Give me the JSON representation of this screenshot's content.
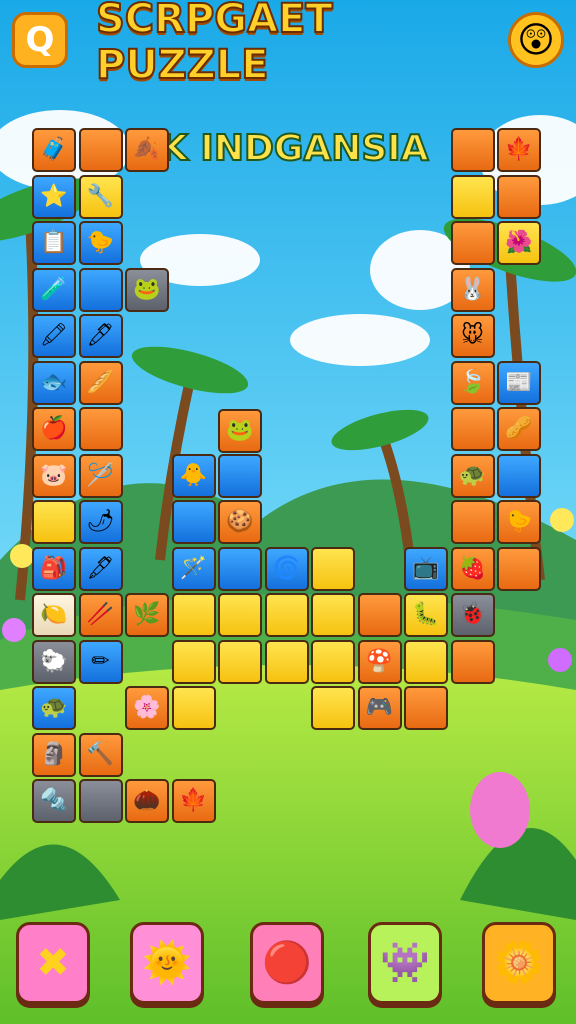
{
  "header": {
    "title": "SCRPGAET PUZZLE",
    "subtitle": "K INDGANSIA",
    "left_icon": "magnifier-q-icon",
    "right_icon": "smiley-face-icon"
  },
  "colors": {
    "sky": "#2fb7ea",
    "grass": "#7fd23c",
    "orange_tile": "#f07a1a",
    "yellow_tile": "#f8cf22",
    "blue_tile": "#1f86f0",
    "gray_tile": "#6c717b"
  },
  "board": {
    "tiles": [
      {
        "c": "orange",
        "icon": "🧳"
      },
      {
        "c": "orange",
        "icon": ""
      },
      {
        "c": "orange",
        "icon": "🍂"
      },
      {
        "c": "orange",
        "icon": ""
      },
      {
        "c": "orange",
        "icon": "🍁"
      },
      {
        "c": "blue",
        "icon": "⭐"
      },
      {
        "c": "yellow",
        "icon": "🔧"
      },
      {
        "c": "yellow",
        "icon": ""
      },
      {
        "c": "orange",
        "icon": ""
      },
      {
        "c": "blue",
        "icon": "📋"
      },
      {
        "c": "blue",
        "icon": "🐤"
      },
      {
        "c": "orange",
        "icon": ""
      },
      {
        "c": "yellow",
        "icon": "🌺"
      },
      {
        "c": "blue",
        "icon": "🧪"
      },
      {
        "c": "blue",
        "icon": ""
      },
      {
        "c": "gray",
        "icon": "🐸"
      },
      {
        "c": "orange",
        "icon": "🐰"
      },
      {
        "c": "blue",
        "icon": "🖍"
      },
      {
        "c": "blue",
        "icon": "🖊"
      },
      {
        "c": "orange",
        "icon": "🐭"
      },
      {
        "c": "blue",
        "icon": "🐟"
      },
      {
        "c": "orange",
        "icon": "🥖"
      },
      {
        "c": "orange",
        "icon": "🍃"
      },
      {
        "c": "blue",
        "icon": "📰"
      },
      {
        "c": "orange",
        "icon": "🍎"
      },
      {
        "c": "orange",
        "icon": ""
      },
      {
        "c": "orange",
        "icon": ""
      },
      {
        "c": "orange",
        "icon": "🥜"
      },
      {
        "c": "orange",
        "icon": "🐷"
      },
      {
        "c": "orange",
        "icon": "🪡"
      },
      {
        "c": "orange",
        "icon": "🐸"
      },
      {
        "c": "orange",
        "icon": "🐢"
      },
      {
        "c": "blue",
        "icon": ""
      },
      {
        "c": "blue",
        "icon": "🐥"
      },
      {
        "c": "blue",
        "icon": ""
      },
      {
        "c": "yellow",
        "icon": ""
      },
      {
        "c": "blue",
        "icon": "🌶"
      },
      {
        "c": "blue",
        "icon": ""
      },
      {
        "c": "orange",
        "icon": "🍪"
      },
      {
        "c": "orange",
        "icon": ""
      },
      {
        "c": "orange",
        "icon": "🐤"
      },
      {
        "c": "blue",
        "icon": "🎒"
      },
      {
        "c": "blue",
        "icon": "🖋"
      },
      {
        "c": "blue",
        "icon": "🪄"
      },
      {
        "c": "blue",
        "icon": ""
      },
      {
        "c": "blue",
        "icon": "🌀"
      },
      {
        "c": "yellow",
        "icon": ""
      },
      {
        "c": "blue",
        "icon": "📺"
      },
      {
        "c": "orange",
        "icon": "🍓"
      },
      {
        "c": "orange",
        "icon": ""
      },
      {
        "c": "white",
        "icon": "🍋"
      },
      {
        "c": "orange",
        "icon": "🥢"
      },
      {
        "c": "orange",
        "icon": "🌿"
      },
      {
        "c": "yellow",
        "icon": ""
      },
      {
        "c": "yellow",
        "icon": ""
      },
      {
        "c": "yellow",
        "icon": ""
      },
      {
        "c": "yellow",
        "icon": ""
      },
      {
        "c": "orange",
        "icon": ""
      },
      {
        "c": "yellow",
        "icon": "🐛"
      },
      {
        "c": "gray",
        "icon": "🐞"
      },
      {
        "c": "gray",
        "icon": "🐑"
      },
      {
        "c": "blue",
        "icon": "✏"
      },
      {
        "c": "yellow",
        "icon": ""
      },
      {
        "c": "yellow",
        "icon": ""
      },
      {
        "c": "yellow",
        "icon": ""
      },
      {
        "c": "yellow",
        "icon": ""
      },
      {
        "c": "orange",
        "icon": "🍄"
      },
      {
        "c": "yellow",
        "icon": ""
      },
      {
        "c": "orange",
        "icon": ""
      },
      {
        "c": "blue",
        "icon": "🐢"
      },
      {
        "c": "orange",
        "icon": "🌸"
      },
      {
        "c": "yellow",
        "icon": ""
      },
      {
        "c": "yellow",
        "icon": ""
      },
      {
        "c": "orange",
        "icon": "🎮"
      },
      {
        "c": "orange",
        "icon": ""
      },
      {
        "c": "orange",
        "icon": "🗿"
      },
      {
        "c": "orange",
        "icon": "🔨"
      },
      {
        "c": "gray",
        "icon": "🔩"
      },
      {
        "c": "gray",
        "icon": ""
      },
      {
        "c": "orange",
        "icon": "🌰"
      },
      {
        "c": "orange",
        "icon": "🍁"
      }
    ]
  },
  "buttons": [
    {
      "icon": "close-x-icon",
      "glyph": "✖",
      "bg": "#ff7fc9"
    },
    {
      "icon": "sun-creature-icon",
      "glyph": "🌞",
      "bg": "#ff8fd6"
    },
    {
      "icon": "ball-icon",
      "glyph": "🔴",
      "bg": "#ff7fb8"
    },
    {
      "icon": "blue-monster-icon",
      "glyph": "👾",
      "bg": "#b8f25a"
    },
    {
      "icon": "sun-flower-icon",
      "glyph": "🌼",
      "bg": "#ffb224"
    }
  ]
}
